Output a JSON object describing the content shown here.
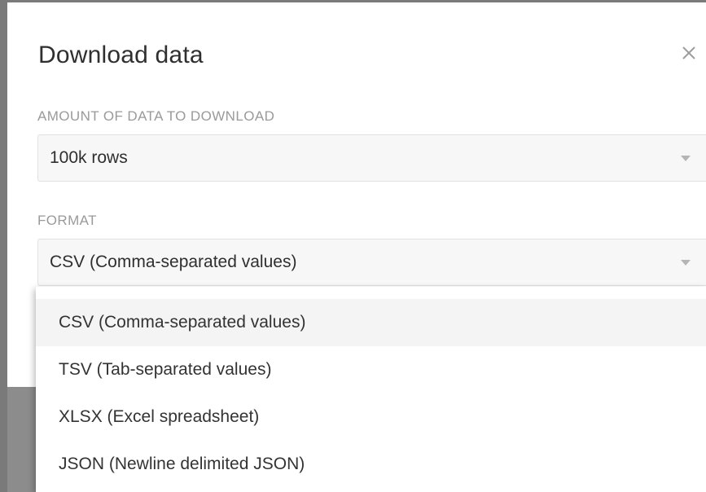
{
  "dialog": {
    "title": "Download data",
    "close_icon": "close-icon"
  },
  "amount": {
    "label": "AMOUNT OF DATA TO DOWNLOAD",
    "value": "100k rows",
    "caret_icon": "caret-down-icon"
  },
  "format": {
    "label": "FORMAT",
    "value": "CSV (Comma-separated values)",
    "caret_icon": "caret-down-icon",
    "options": [
      {
        "label": "CSV (Comma-separated values)",
        "selected": true
      },
      {
        "label": "TSV (Tab-separated values)",
        "selected": false
      },
      {
        "label": "XLSX (Excel spreadsheet)",
        "selected": false
      },
      {
        "label": "JSON (Newline delimited JSON)",
        "selected": false
      }
    ]
  },
  "colors": {
    "backdrop": "#8c8c8c",
    "select_background": "#f7f7f7",
    "label_gray": "#9a9a9a",
    "highlight": "#f4f4f4"
  }
}
